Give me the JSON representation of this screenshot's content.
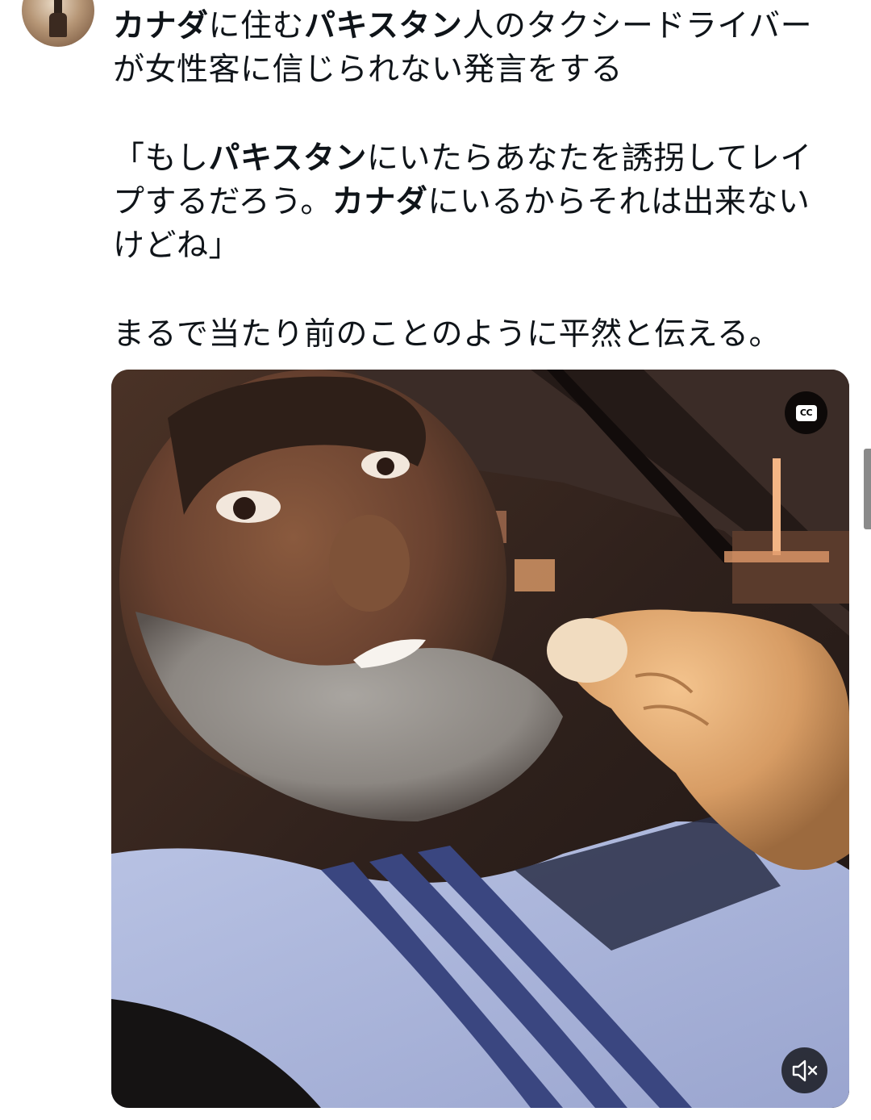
{
  "author": {
    "avatar_icon": "avatar-photo",
    "header_partial": "…"
  },
  "tweet": {
    "paragraph1": {
      "segments": [
        {
          "text": "カナダ",
          "bold": true
        },
        {
          "text": "に住む",
          "bold": false
        },
        {
          "text": "パキスタン",
          "bold": true
        },
        {
          "text": "人のタクシードライバーが女性客に信じられない発言をする",
          "bold": false
        }
      ]
    },
    "paragraph2": {
      "segments": [
        {
          "text": "「もし",
          "bold": false
        },
        {
          "text": "パキスタン",
          "bold": true
        },
        {
          "text": "にいたらあなたを誘拐してレイプするだろう。",
          "bold": false
        },
        {
          "text": "カナダ",
          "bold": true
        },
        {
          "text": "にいるからそれは出来ないけどね」",
          "bold": false
        }
      ]
    },
    "paragraph3": {
      "segments": [
        {
          "text": "まるで当たり前のことのように平然と伝える。",
          "bold": false
        }
      ]
    }
  },
  "media": {
    "type": "video",
    "cc_label": "CC",
    "cc_icon": "closed-captions-icon",
    "mute_icon": "speaker-muted-icon"
  },
  "colors": {
    "text": "#0f1419",
    "background": "#ffffff",
    "overlay_button": "#000000"
  }
}
